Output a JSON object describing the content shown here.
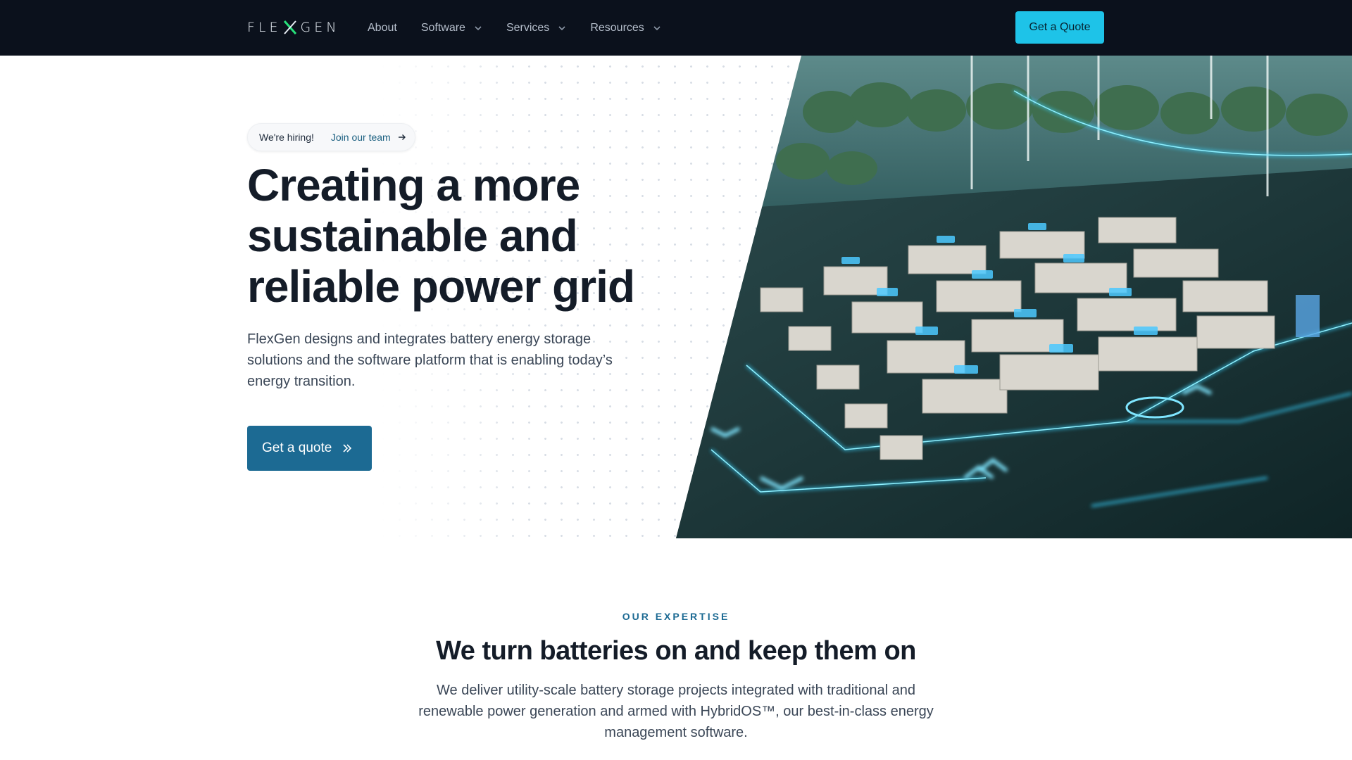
{
  "nav": {
    "logo_text_left": "FLE",
    "logo_text_right": "GEN",
    "items": [
      {
        "label": "About",
        "has_dropdown": false
      },
      {
        "label": "Software",
        "has_dropdown": true
      },
      {
        "label": "Services",
        "has_dropdown": true
      },
      {
        "label": "Resources",
        "has_dropdown": true
      }
    ],
    "cta_label": "Get a Quote"
  },
  "hero": {
    "pill_badge": "We're hiring!",
    "pill_link": "Join our team",
    "title": "Creating a more sustainable and reliable power grid",
    "lead": "FlexGen designs and integrates battery energy storage solutions and the software platform that is enabling today’s energy transition.",
    "cta_label": "Get a quote"
  },
  "expertise": {
    "eyebrow": "OUR EXPERTISE",
    "title": "We turn batteries on and keep them on",
    "body": "We deliver utility-scale battery storage projects integrated with traditional and renewable power generation and armed with HybridOS™, our best-in-class energy management software."
  },
  "colors": {
    "nav_bg": "#0b111c",
    "accent_cyan": "#1ec3e8",
    "primary_blue": "#1c6a93",
    "heading": "#141c28"
  },
  "icons": {
    "chevron": "chevron-down-icon",
    "arrow": "arrow-right-icon",
    "double_chevron": "double-chevron-right-icon"
  }
}
